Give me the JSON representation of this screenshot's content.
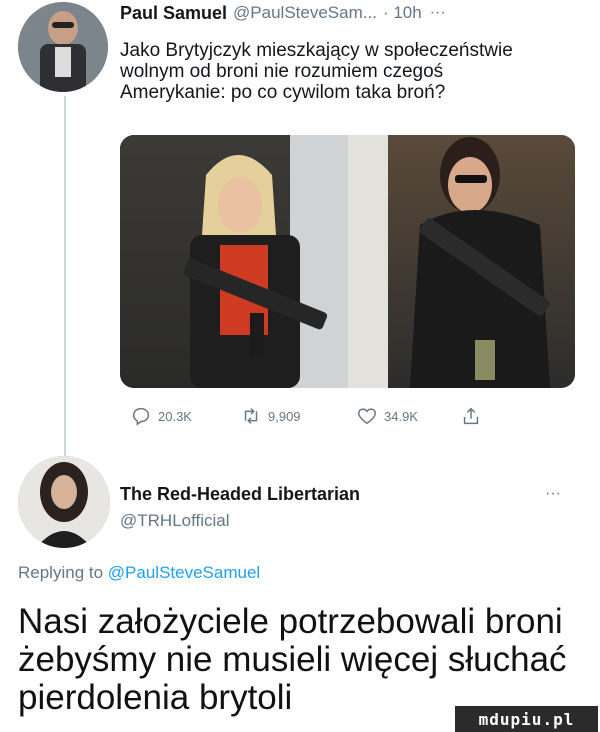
{
  "tweet": {
    "author_name": "Paul Samuel",
    "author_handle": "@PaulSteveSam...",
    "time": "· 10h",
    "more": "···",
    "text_lines": [
      "Jako Brytyjczyk mieszkający w społeczeństwie",
      "wolnym od broni nie rozumiem czegoś",
      "Amerykanie: po co cywilom taka broń?"
    ],
    "actions": {
      "replies": "20.3K",
      "retweets": "9,909",
      "likes": "34.9K"
    }
  },
  "reply": {
    "author_name": "The Red-Headed Libertarian",
    "author_handle": "@TRHLofficial",
    "more": "···",
    "replying_to_prefix": "Replying to",
    "replying_to_handle": "@PaulSteveSamuel"
  },
  "caption": {
    "lines": [
      "Nasi założyciele potrzebowali broni",
      "żebyśmy nie musieli więcej słuchać",
      "pierdolenia brytoli"
    ]
  },
  "watermark": "mdupiu.pl",
  "colors": {
    "link": "#1da1f2",
    "muted": "#657786",
    "text": "#14171a"
  },
  "icons": [
    "reply-icon",
    "retweet-icon",
    "like-icon",
    "share-icon"
  ]
}
